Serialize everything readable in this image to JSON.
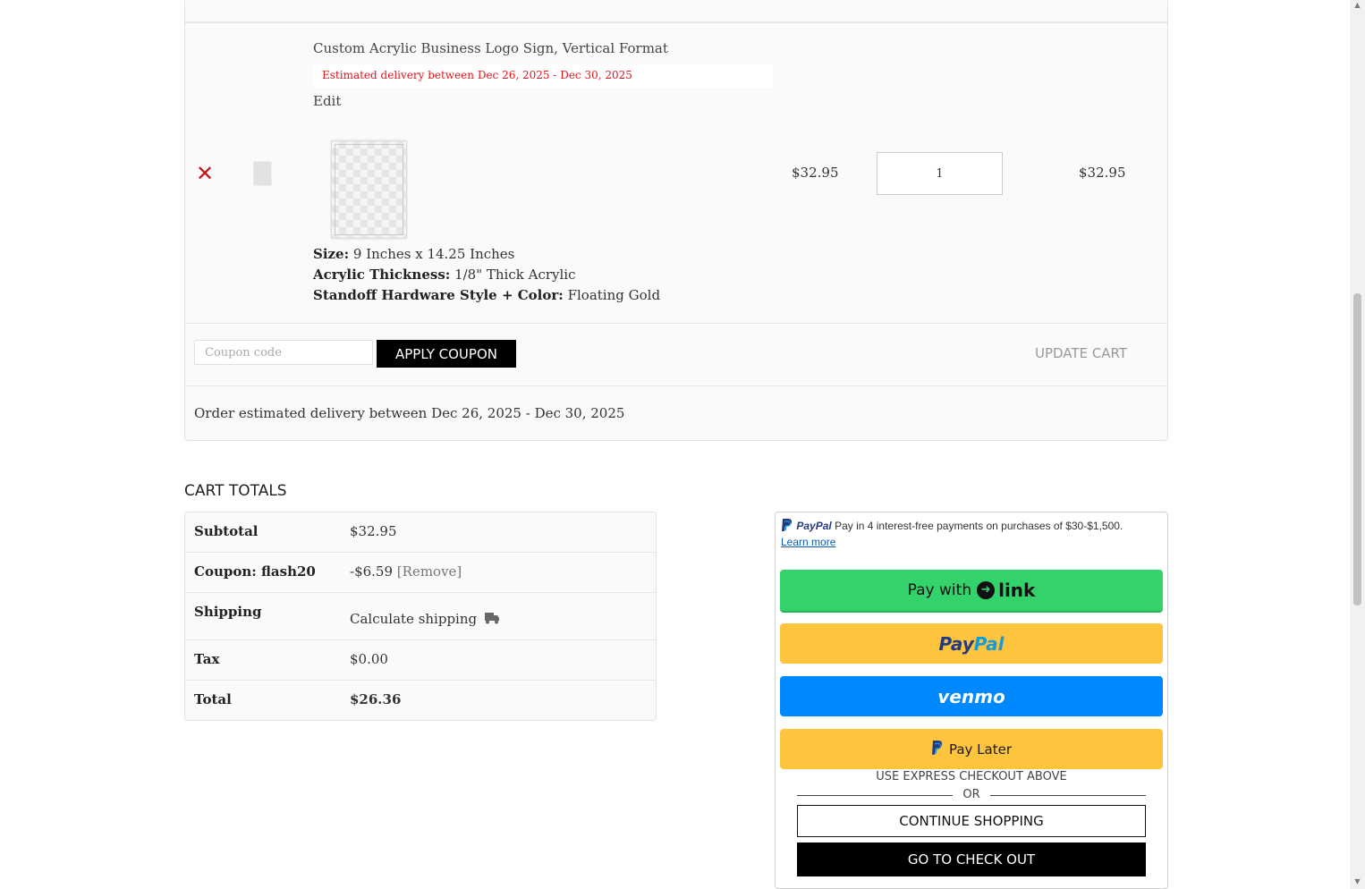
{
  "cart": {
    "item": {
      "remove_glyph": "✕",
      "name": "Custom Acrylic Business Logo Sign, Vertical Format",
      "eta": "Estimated delivery between Dec 26, 2025 - Dec 30, 2025",
      "edit_label": "Edit",
      "attributes": [
        {
          "label": "Size:",
          "value": " 9 Inches x 14.25 Inches"
        },
        {
          "label": "Acrylic Thickness:",
          "value": " 1/8\" Thick Acrylic"
        },
        {
          "label": "Standoff Hardware Style + Color:",
          "value": " Floating Gold"
        }
      ],
      "price": "$32.95",
      "quantity": "1",
      "line_total": "$32.95"
    },
    "coupon": {
      "placeholder": "Coupon code",
      "apply_label": "APPLY COUPON",
      "update_label": "UPDATE CART"
    },
    "order_eta": "Order estimated delivery between Dec 26, 2025 - Dec 30, 2025"
  },
  "totals": {
    "title": "CART TOTALS",
    "rows": [
      {
        "label": "Subtotal",
        "value": "$32.95"
      },
      {
        "label": "Coupon: flash20",
        "value": "-$6.59",
        "extra": "[Remove]"
      },
      {
        "label": "Shipping",
        "value": "Calculate shipping",
        "icon": "truck-icon"
      },
      {
        "label": "Tax",
        "value": "$0.00"
      },
      {
        "label": "Total",
        "value": "$26.36"
      }
    ]
  },
  "payments": {
    "paypal_brand": "PayPal",
    "paypal_message": "Pay in 4 interest-free payments on purchases of $30-$1,500.",
    "learn_more": "Learn more",
    "link_prefix": "Pay with",
    "link_word": "link",
    "paypal_btn": {
      "pay": "Pay",
      "pal": "Pal"
    },
    "venmo_label": "venmo",
    "pay_later_label": "Pay Later",
    "express_note": "USE EXPRESS CHECKOUT ABOVE",
    "or_label": "OR",
    "continue_label": "CONTINUE SHOPPING",
    "checkout_label": "GO TO CHECK OUT"
  },
  "colors": {
    "eta_red": "#e3141c",
    "remove_red": "#c0171f",
    "link_green": "#33d26b",
    "paypal_yellow": "#fec43d",
    "venmo_blue": "#0089ff"
  }
}
